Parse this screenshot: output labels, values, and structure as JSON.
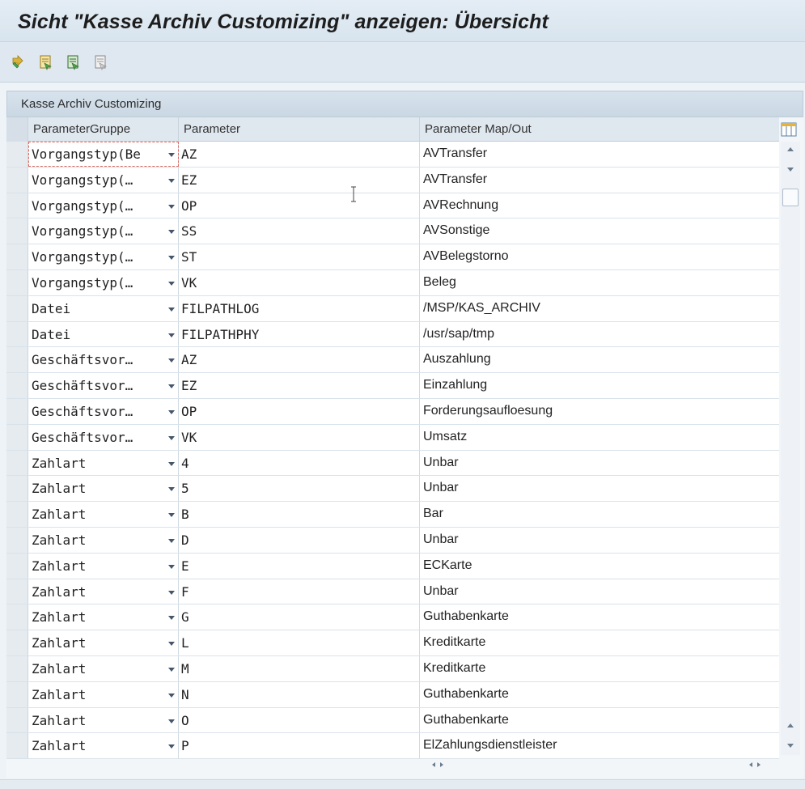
{
  "window": {
    "title": "Sicht \"Kasse Archiv Customizing\" anzeigen: Übersicht"
  },
  "toolbar": {
    "buttons": [
      {
        "icon": "other-view-icon"
      },
      {
        "icon": "select-all-icon"
      },
      {
        "icon": "select-block-icon"
      },
      {
        "icon": "deselect-all-icon"
      }
    ]
  },
  "panel": {
    "title": "Kasse Archiv Customizing"
  },
  "table": {
    "columns": [
      "ParameterGruppe",
      "Parameter",
      "Parameter Map/Out"
    ],
    "rows": [
      {
        "group": "Vorgangstyp(Be",
        "param": "AZ",
        "map": "AVTransfer"
      },
      {
        "group": "Vorgangstyp(…",
        "param": "EZ",
        "map": "AVTransfer"
      },
      {
        "group": "Vorgangstyp(…",
        "param": "OP",
        "map": "AVRechnung"
      },
      {
        "group": "Vorgangstyp(…",
        "param": "SS",
        "map": "AVSonstige"
      },
      {
        "group": "Vorgangstyp(…",
        "param": "ST",
        "map": "AVBelegstorno"
      },
      {
        "group": "Vorgangstyp(…",
        "param": "VK",
        "map": "Beleg"
      },
      {
        "group": "Datei",
        "param": "FILPATHLOG",
        "map": "/MSP/KAS_ARCHIV"
      },
      {
        "group": "Datei",
        "param": "FILPATHPHY",
        "map": "/usr/sap/tmp"
      },
      {
        "group": "Geschäftsvor…",
        "param": "AZ",
        "map": "Auszahlung"
      },
      {
        "group": "Geschäftsvor…",
        "param": "EZ",
        "map": "Einzahlung"
      },
      {
        "group": "Geschäftsvor…",
        "param": "OP",
        "map": "Forderungsaufloesung"
      },
      {
        "group": "Geschäftsvor…",
        "param": "VK",
        "map": "Umsatz"
      },
      {
        "group": "Zahlart",
        "param": "4",
        "map": "Unbar"
      },
      {
        "group": "Zahlart",
        "param": "5",
        "map": "Unbar"
      },
      {
        "group": "Zahlart",
        "param": "B",
        "map": "Bar"
      },
      {
        "group": "Zahlart",
        "param": "D",
        "map": "Unbar"
      },
      {
        "group": "Zahlart",
        "param": "E",
        "map": "ECKarte"
      },
      {
        "group": "Zahlart",
        "param": "F",
        "map": "Unbar"
      },
      {
        "group": "Zahlart",
        "param": "G",
        "map": "Guthabenkarte"
      },
      {
        "group": "Zahlart",
        "param": "L",
        "map": "Kreditkarte"
      },
      {
        "group": "Zahlart",
        "param": "M",
        "map": "Kreditkarte"
      },
      {
        "group": "Zahlart",
        "param": "N",
        "map": "Guthabenkarte"
      },
      {
        "group": "Zahlart",
        "param": "O",
        "map": "Guthabenkarte"
      },
      {
        "group": "Zahlart",
        "param": "P",
        "map": "ElZahlungsdienstleister"
      }
    ]
  },
  "colors": {
    "title_bg": "#dce7f0",
    "focus_border": "#e06a5f",
    "toolbar_icon_yellow": "#d9b23a",
    "toolbar_icon_green": "#4ea34a"
  }
}
